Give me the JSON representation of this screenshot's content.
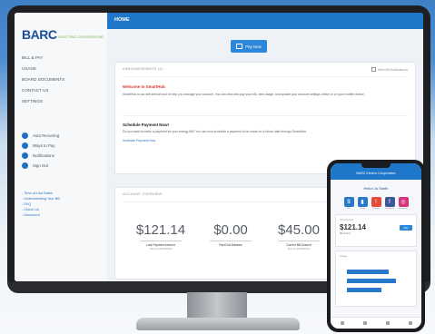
{
  "app": {
    "logo_text": "BARC",
    "logo_subtitle": "ELECTRIC COOPERATIVE",
    "page_title": "HOME"
  },
  "sidebar": {
    "items": [
      {
        "label": "BILL & PAY"
      },
      {
        "label": "USAGE"
      },
      {
        "label": "BOARD DOCUMENTS"
      },
      {
        "label": "CONTACT US"
      },
      {
        "label": "SETTINGS"
      }
    ],
    "sub_items": [
      {
        "label": "Auto Recurring"
      },
      {
        "label": "Ways to Pay"
      },
      {
        "label": "Notifications"
      },
      {
        "label": "Sign Out"
      }
    ],
    "links": [
      {
        "label": "- Time-of-Use Rates"
      },
      {
        "label": "- Understanding Your Bill"
      },
      {
        "label": "- FAQ"
      },
      {
        "label": "- Check Us"
      },
      {
        "label": "- Document"
      }
    ]
  },
  "main": {
    "pay_button": "Pay Now",
    "announcements": {
      "header": "ANNOUNCEMENTS (2)",
      "view_all": "View All Notifications",
      "messages": [
        {
          "title": "Welcome to SmartHub",
          "body": "SmartHub is our self service tool to help you manage your account. You can view and pay your bill, view usage, and update your account settings online or on your mobile device.",
          "link": ""
        },
        {
          "title": "Schedule Payment Now!",
          "body": "Do you want to make a payment for your energy bill? You can now schedule a payment to be made on a future date through SmartHub.",
          "link": "Schedule Payment Now"
        }
      ]
    },
    "account_overview": {
      "header": "ACCOUNT OVERVIEW",
      "stats": [
        {
          "value": "$121.14",
          "label": "Last Payment Amount",
          "sub": "Paid on 09/15/2023"
        },
        {
          "value": "$0.00",
          "label": "Past Due Balance",
          "sub": ""
        },
        {
          "value": "$45.00",
          "label": "Current Bill Amount",
          "sub": "Due on 10/06/2023"
        }
      ]
    }
  },
  "phone": {
    "title": "BARC Electric Cooperative",
    "greeting": "Hello! Jo Smith",
    "icons": [
      {
        "name": "bill",
        "label": "Bill",
        "color": "#2a78c9",
        "glyph": "$"
      },
      {
        "name": "usage",
        "label": "Usage",
        "color": "#2a78c9",
        "glyph": "▮"
      },
      {
        "name": "outage",
        "label": "Outage",
        "color": "#e24c3d",
        "glyph": "!"
      },
      {
        "name": "facebook",
        "label": "Facebook",
        "color": "#3b5998",
        "glyph": "f"
      },
      {
        "name": "instagram",
        "label": "Instagram",
        "color": "#d6337b",
        "glyph": "◎"
      }
    ],
    "amount_header": "Amount Due",
    "amount": "$121.14",
    "amount_label": "Bill Amount",
    "pay_label": "Pay",
    "usage_header": "Usage",
    "colors": {
      "header": "#1f77c9",
      "accent": "#2a78c9"
    }
  }
}
